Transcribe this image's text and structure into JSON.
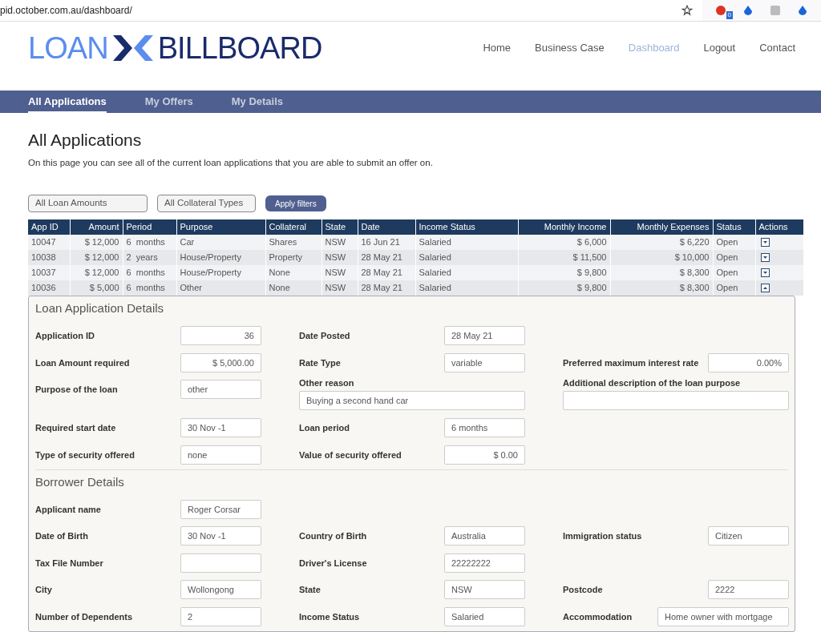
{
  "browser": {
    "url": "pid.october.com.au/dashboard/",
    "extension_badge": "0"
  },
  "logo": {
    "left": "LOAN",
    "right": "BILLBOARD"
  },
  "nav": [
    {
      "label": "Home",
      "selected": false
    },
    {
      "label": "Business Case",
      "selected": false
    },
    {
      "label": "Dashboard",
      "selected": true
    },
    {
      "label": "Logout",
      "selected": false
    },
    {
      "label": "Contact",
      "selected": false
    }
  ],
  "tabs": [
    {
      "label": "All Applications",
      "selected": true
    },
    {
      "label": "My Offers",
      "selected": false
    },
    {
      "label": "My Details",
      "selected": false
    }
  ],
  "page": {
    "title": "All Applications",
    "description": "On this page you can see all of the current loan applications that you are able to submit an offer on."
  },
  "filters": {
    "amount": "All Loan Amounts",
    "collateral": "All Collateral Types",
    "apply": "Apply filters"
  },
  "table": {
    "columns": [
      {
        "label": "App ID",
        "numeric": false
      },
      {
        "label": "Amount",
        "numeric": true
      },
      {
        "label": "Period",
        "numeric": false
      },
      {
        "label": "Purpose",
        "numeric": false
      },
      {
        "label": "Collateral",
        "numeric": false
      },
      {
        "label": "State",
        "numeric": false
      },
      {
        "label": "Date",
        "numeric": false
      },
      {
        "label": "Income Status",
        "numeric": false
      },
      {
        "label": "Monthly Income",
        "numeric": true
      },
      {
        "label": "Monthly Expenses",
        "numeric": true
      },
      {
        "label": "Status",
        "numeric": false
      },
      {
        "label": "Actions",
        "numeric": false
      }
    ],
    "rows": [
      {
        "cells": [
          "10047",
          "$ 12,000",
          "6  months",
          "Car",
          "Shares",
          "NSW",
          "16 Jun 21",
          "Salaried",
          "$ 6,000",
          "$ 6,220",
          "Open"
        ],
        "expanded": false
      },
      {
        "cells": [
          "10038",
          "$ 12,000",
          "2  years",
          "House/Property",
          "Property",
          "NSW",
          "28 May 21",
          "Salaried",
          "$ 11,500",
          "$ 10,000",
          "Open"
        ],
        "expanded": false
      },
      {
        "cells": [
          "10037",
          "$ 12,000",
          "6  months",
          "House/Property",
          "None",
          "NSW",
          "28 May 21",
          "Salaried",
          "$ 9,800",
          "$ 8,300",
          "Open"
        ],
        "expanded": false
      },
      {
        "cells": [
          "10036",
          "$ 5,000",
          "6  months",
          "Other",
          "None",
          "NSW",
          "28 May 21",
          "Salaried",
          "$ 9,800",
          "$ 8,300",
          "Open"
        ],
        "expanded": true
      }
    ]
  },
  "details": [
    {
      "title": "Loan Application Details",
      "rows": [
        [
          {
            "kind": "inline",
            "label": "Application ID",
            "value": "36",
            "numeric": true
          },
          {
            "kind": "inline",
            "label": "Date Posted",
            "value": "28 May 21",
            "numeric": false
          },
          {
            "kind": "blank"
          }
        ],
        [
          {
            "kind": "inline",
            "label": "Loan Amount required",
            "value": "$ 5,000.00",
            "numeric": true
          },
          {
            "kind": "inline",
            "label": "Rate Type",
            "value": "variable",
            "numeric": false
          },
          {
            "kind": "inline",
            "label": "Preferred maximum interest rate",
            "value": "0.00%",
            "numeric": true
          }
        ],
        [
          {
            "kind": "inline",
            "label": "Purpose of the loan",
            "value": "other",
            "numeric": false
          },
          {
            "kind": "stacked",
            "label": "Other reason",
            "value": "Buying a second hand car",
            "numeric": false
          },
          {
            "kind": "stacked",
            "label": "Additional description of the loan purpose"
          }
        ],
        [
          {
            "kind": "inline",
            "label": "Required start date",
            "value": "30 Nov -1",
            "numeric": false
          },
          {
            "kind": "inline",
            "label": "Loan period",
            "value": "6 months",
            "numeric": false
          },
          {
            "kind": "blank"
          }
        ],
        [
          {
            "kind": "inline",
            "label": "Type of security offered",
            "value": "none",
            "numeric": false
          },
          {
            "kind": "inline",
            "label": "Value of security offered",
            "value": "$ 0.00",
            "numeric": true
          },
          {
            "kind": "blank"
          }
        ]
      ]
    },
    {
      "title": "Borrower Details",
      "rows": [
        [
          {
            "kind": "inline",
            "label": "Applicant name",
            "value": "Roger Corsar",
            "numeric": false
          },
          {
            "kind": "blank"
          },
          {
            "kind": "blank"
          }
        ],
        [
          {
            "kind": "inline",
            "label": "Date of Birth",
            "value": "30 Nov -1",
            "numeric": false
          },
          {
            "kind": "inline",
            "label": "Country of Birth",
            "value": "Australia",
            "numeric": false
          },
          {
            "kind": "inline",
            "label": "Immigration status",
            "value": "Citizen",
            "numeric": false
          }
        ],
        [
          {
            "kind": "inline",
            "label": "Tax File Number"
          },
          {
            "kind": "inline",
            "label": "Driver's License",
            "value": "22222222",
            "numeric": false
          },
          {
            "kind": "blank"
          }
        ],
        [
          {
            "kind": "inline",
            "label": "City",
            "value": "Wollongong",
            "numeric": false
          },
          {
            "kind": "inline",
            "label": "State",
            "value": "NSW",
            "numeric": false
          },
          {
            "kind": "inline",
            "label": "Postcode",
            "value": "2222",
            "numeric": false
          }
        ],
        [
          {
            "kind": "inline",
            "label": "Number of Dependents",
            "value": "2",
            "numeric": false
          },
          {
            "kind": "inline",
            "label": "Income Status",
            "value": "Salaried",
            "numeric": false
          },
          {
            "kind": "wide",
            "label": "Accommodation",
            "value": "Home owner with mortgage",
            "numeric": false
          }
        ]
      ]
    }
  ]
}
